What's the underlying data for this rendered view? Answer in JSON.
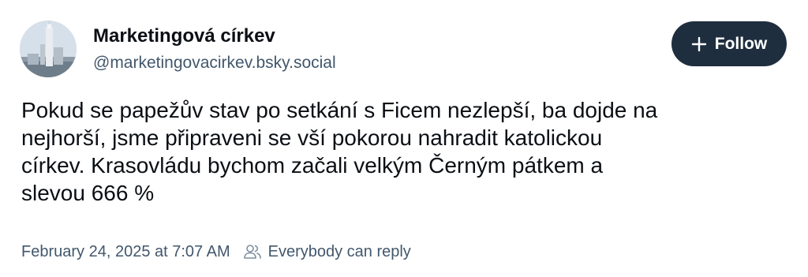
{
  "author": {
    "name": "Marketingová církev",
    "handle": "@marketingovacirkev.bsky.social",
    "avatar_icon": "church-tower-avatar"
  },
  "follow_button": {
    "label": "Follow",
    "icon": "plus-icon",
    "background": "#1f2e3e",
    "text_color": "#ffffff"
  },
  "post": {
    "lines": [
      "Pokud se papežův stav po setkání s Ficem nezlepší, ba dojde na",
      "nejhorší, jsme připraveni se vší pokorou nahradit katolickou",
      "církev. Krasovládu bychom začali velkým Černým pátkem a",
      "slevou 666 %"
    ]
  },
  "meta": {
    "timestamp": "February 24, 2025 at 7:07 AM",
    "reply_icon": "people-icon",
    "reply_setting": "Everybody can reply"
  },
  "colors": {
    "text_primary": "#0b0f14",
    "text_secondary": "#42576c",
    "background": "#ffffff"
  }
}
